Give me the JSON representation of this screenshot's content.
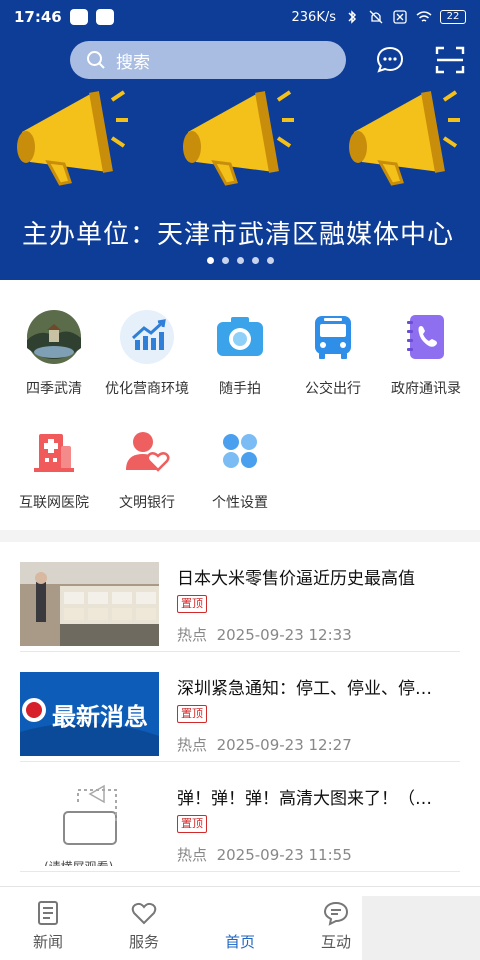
{
  "status_bar": {
    "time": "17:46",
    "network_speed": "236K/s",
    "battery": "22"
  },
  "header": {
    "search_placeholder": "搜索",
    "icons": [
      "search-icon",
      "message-icon",
      "scan-icon"
    ]
  },
  "banner": {
    "caption": "主办单位：天津市武清区融媒体中心",
    "slide_count": 5,
    "active_slide": 1,
    "background_color": "#0e3d97"
  },
  "services": [
    {
      "label": "四季武清",
      "icon": "landscape-photo-icon"
    },
    {
      "label": "优化营商环境",
      "icon": "chart-icon"
    },
    {
      "label": "随手拍",
      "icon": "camera-icon"
    },
    {
      "label": "公交出行",
      "icon": "bus-icon"
    },
    {
      "label": "政府通讯录",
      "icon": "phone-book-icon"
    },
    {
      "label": "互联网医院",
      "icon": "hospital-icon"
    },
    {
      "label": "文明银行",
      "icon": "user-heart-icon"
    },
    {
      "label": "个性设置",
      "icon": "grid-settings-icon"
    }
  ],
  "news": [
    {
      "title": "日本大米零售价逼近历史最高值",
      "tag": "置顶",
      "category": "热点",
      "time": "2025-09-23 12:33"
    },
    {
      "title": "深圳紧急通知：停工、停业、停…",
      "tag": "置顶",
      "category": "热点",
      "time": "2025-09-23 12:27",
      "thumb_text": "最新消息"
    },
    {
      "title": "弹！弹！弹！高清大图来了！（…",
      "tag": "置顶",
      "category": "热点",
      "time": "2025-09-23 11:55",
      "thumb_text": "(请横屏观看)"
    }
  ],
  "tabs": [
    {
      "label": "新闻",
      "icon": "newspaper-icon"
    },
    {
      "label": "服务",
      "icon": "heart-icon"
    },
    {
      "label": "首页",
      "icon": "logo-icon",
      "active": true
    },
    {
      "label": "互动",
      "icon": "chat-icon"
    }
  ],
  "colors": {
    "accent": "#1e66c4",
    "tag": "#d02a2a"
  }
}
